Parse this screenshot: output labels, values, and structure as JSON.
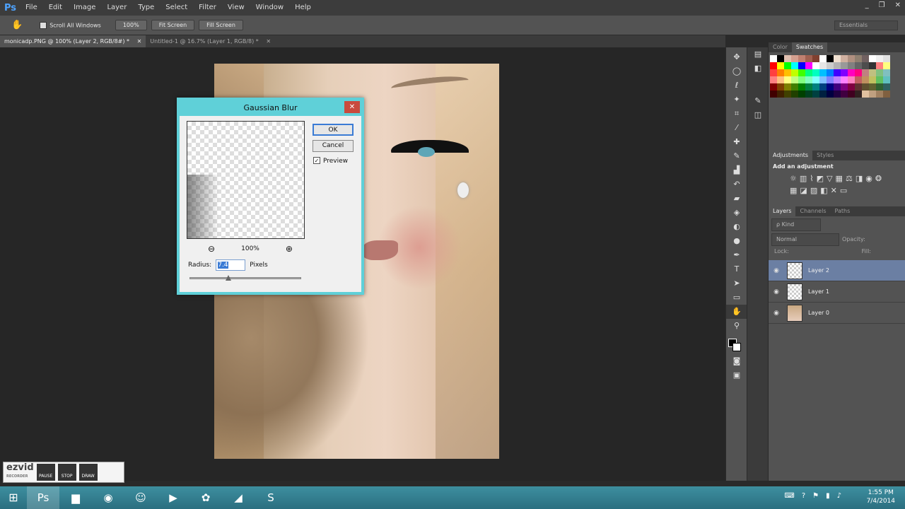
{
  "app": {
    "logo": "Ps",
    "menus": [
      "File",
      "Edit",
      "Image",
      "Layer",
      "Type",
      "Select",
      "Filter",
      "View",
      "Window",
      "Help"
    ]
  },
  "window_controls": [
    "_",
    "❐",
    "✕"
  ],
  "options": {
    "scroll_all": "Scroll All Windows",
    "zoom100": "100%",
    "fit_screen": "Fit Screen",
    "fill_screen": "Fill Screen",
    "workspace": "Essentials"
  },
  "tabs": [
    {
      "label": "monicadp.PNG @ 100% (Layer 2, RGB/8#) *",
      "close": "✕"
    },
    {
      "label": "Untitled-1 @ 16.7% (Layer 1, RGB/8) *",
      "close": "✕"
    }
  ],
  "dialog": {
    "title": "Gaussian Blur",
    "close": "✕",
    "ok": "OK",
    "cancel": "Cancel",
    "preview_label": "Preview",
    "preview_checked": "✓",
    "zoom_out": "⊖",
    "zoom_in": "⊕",
    "zoom": "100%",
    "radius_label": "Radius:",
    "radius_value": "7.4",
    "radius_unit": "Pixels"
  },
  "color_panel": {
    "tabs": [
      "Color",
      "Swatches"
    ],
    "active": "Swatches"
  },
  "adjustments": {
    "tabs": [
      "Adjustments",
      "Styles"
    ],
    "heading": "Add an adjustment"
  },
  "layers_panel": {
    "tabs": [
      "Layers",
      "Channels",
      "Paths"
    ],
    "kind": "ρ Kind",
    "blend": "Normal",
    "opacity_label": "Opacity:",
    "lock_label": "Lock:",
    "fill_label": "Fill:",
    "layers": [
      {
        "name": "Layer 2",
        "selected": true
      },
      {
        "name": "Layer 1",
        "selected": false
      },
      {
        "name": "Layer 0",
        "selected": false
      }
    ]
  },
  "ezvid": {
    "logo": "ezvid",
    "sub": "RECORDER",
    "buttons": [
      "PAUSE",
      "STOP",
      "DRAW"
    ]
  },
  "taskbar": {
    "time": "1:55 PM",
    "date": "7/4/2014"
  }
}
